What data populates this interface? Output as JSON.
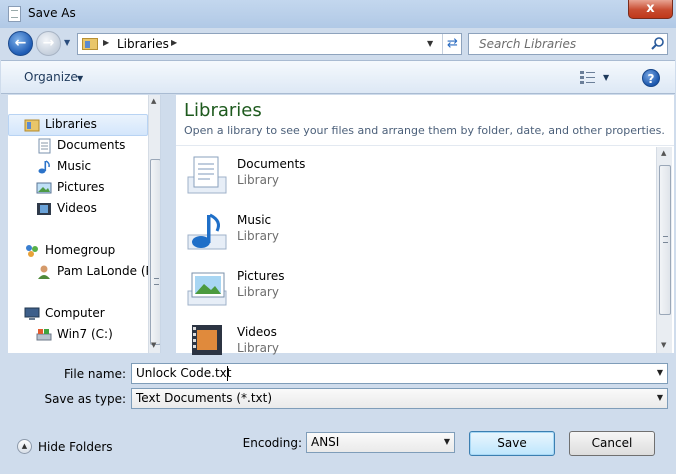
{
  "window": {
    "title": "Save As",
    "close_glyph": "x"
  },
  "address": {
    "crumbs": [
      "Libraries"
    ],
    "search_placeholder": "Search Libraries"
  },
  "toolbar": {
    "organize_label": "Organize"
  },
  "nav": {
    "items": [
      {
        "label": "Libraries",
        "icon": "libraries-icon"
      },
      {
        "label": "Documents",
        "icon": "documents-icon"
      },
      {
        "label": "Music",
        "icon": "music-icon"
      },
      {
        "label": "Pictures",
        "icon": "pictures-icon"
      },
      {
        "label": "Videos",
        "icon": "videos-icon"
      },
      {
        "label": "Homegroup",
        "icon": "homegroup-icon"
      },
      {
        "label": "Pam LaLonde (PA",
        "icon": "user-icon"
      },
      {
        "label": "Computer",
        "icon": "computer-icon"
      },
      {
        "label": "Win7 (C:)",
        "icon": "drive-icon"
      }
    ]
  },
  "content": {
    "title": "Libraries",
    "subtitle": "Open a library to see your files and arrange them by folder, date, and other properties.",
    "libraries": [
      {
        "name": "Documents",
        "type": "Library"
      },
      {
        "name": "Music",
        "type": "Library"
      },
      {
        "name": "Pictures",
        "type": "Library"
      },
      {
        "name": "Videos",
        "type": "Library"
      }
    ]
  },
  "form": {
    "file_name_label": "File name:",
    "file_name_value": "Unlock Code.txt",
    "save_type_label": "Save as type:",
    "save_type_value": "Text Documents (*.txt)",
    "encoding_label": "Encoding:",
    "encoding_value": "ANSI",
    "save_label": "Save",
    "cancel_label": "Cancel",
    "hide_folders_label": "Hide Folders"
  },
  "colors": {
    "accent_green": "#1e5a1e",
    "chrome_blue": "#cfdcec"
  }
}
